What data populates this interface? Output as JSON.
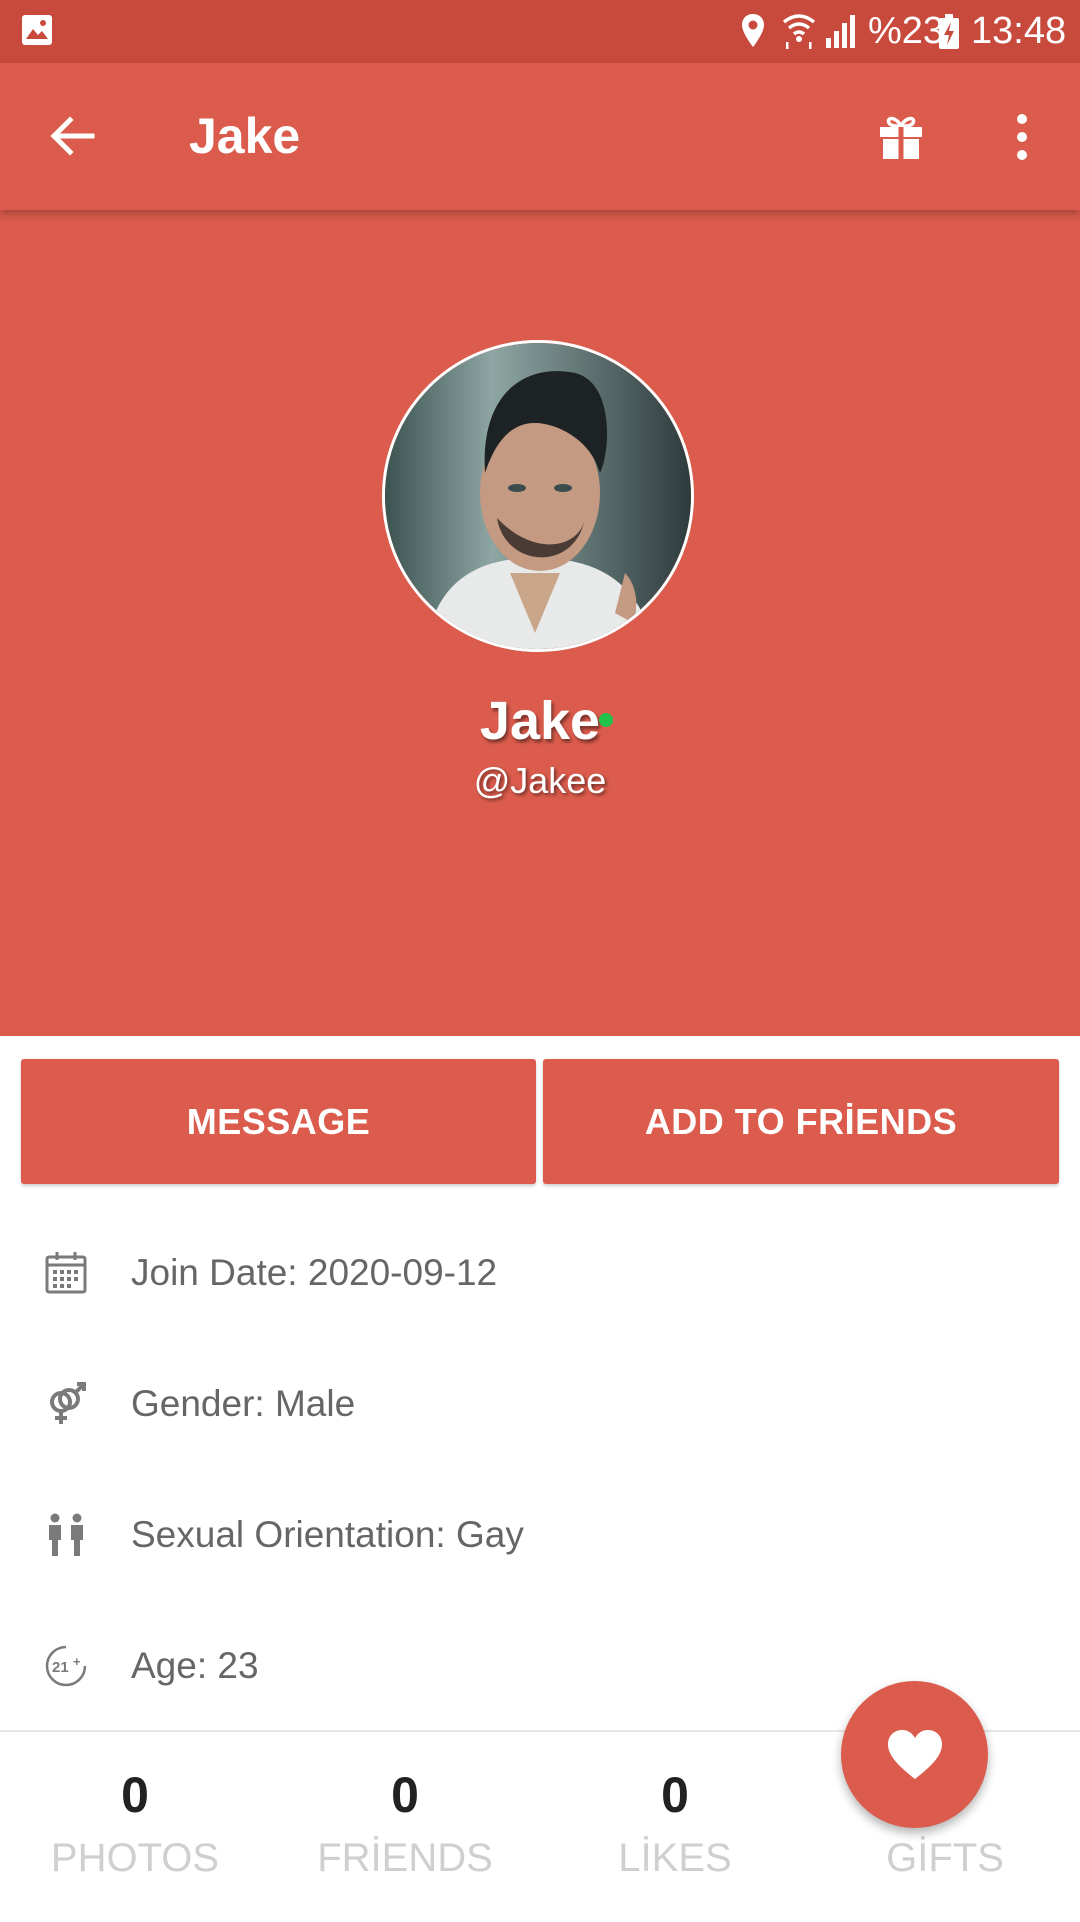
{
  "status_bar": {
    "battery_text": "%23",
    "time": "13:48",
    "icons": [
      "image-icon",
      "location-icon",
      "wifi-icon",
      "signal-icon",
      "battery-charging-icon"
    ]
  },
  "app_bar": {
    "title": "Jake",
    "icons": [
      "back-arrow-icon",
      "gift-icon",
      "more-vert-icon"
    ]
  },
  "profile": {
    "name": "Jake",
    "username": "@Jakee",
    "online": true
  },
  "actions": {
    "message_label": "MESSAGE",
    "add_friend_label": "ADD TO FRİENDS"
  },
  "info": {
    "join_date": "Join Date: 2020-09-12",
    "gender": "Gender: Male",
    "orientation": "Sexual Orientation: Gay",
    "age": "Age: 23"
  },
  "stats": {
    "photos": {
      "value": "0",
      "label": "PHOTOS"
    },
    "friends": {
      "value": "0",
      "label": "FRİENDS"
    },
    "likes": {
      "value": "0",
      "label": "LİKES"
    },
    "gifts": {
      "label": "GİFTS"
    }
  },
  "colors": {
    "accent": "#db5c4c",
    "status_bar": "#c74a3d",
    "online": "#20c24a"
  }
}
